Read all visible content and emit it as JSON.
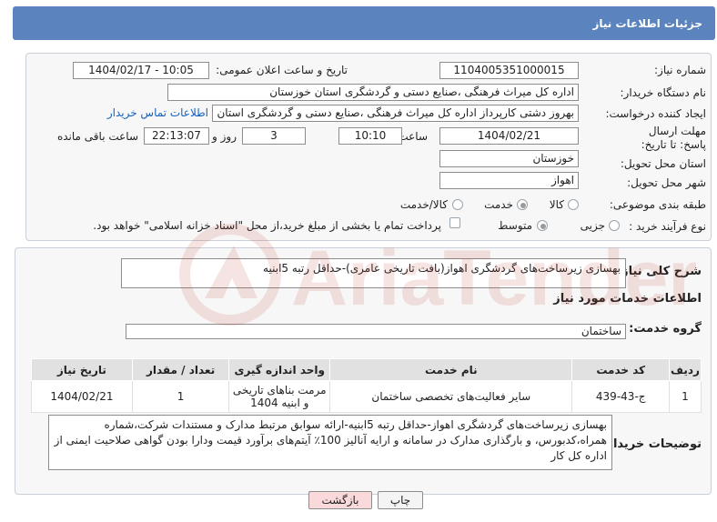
{
  "header": {
    "title": "جزئیات اطلاعات نیاز"
  },
  "form": {
    "need_number": {
      "label": "شماره نیاز:",
      "value": "1104005351000015"
    },
    "announce_datetime": {
      "label": "تاریخ و ساعت اعلان عمومی:",
      "value": "1404/02/17 - 10:05"
    },
    "buyer_org": {
      "label": "نام دستگاه خریدار:",
      "value": "اداره کل میراث فرهنگی ،صنایع دستی و گردشگری استان خوزستان"
    },
    "requester": {
      "label": "ایجاد کننده درخواست:",
      "value": "بهروز دشتی کارپرداز اداره کل میراث فرهنگی ،صنایع دستی و گردشگری استان خوزستان",
      "contact_link": "اطلاعات تماس خریدار"
    },
    "deadline": {
      "label": "مهلت ارسال پاسخ: تا تاریخ:",
      "date": "1404/02/21",
      "time_label": "ساعت",
      "time": "10:10",
      "days": "3",
      "days_label": "روز و",
      "remaining": "22:13:07",
      "remaining_label": "ساعت باقی مانده"
    },
    "province": {
      "label": "استان محل تحویل:",
      "value": "خوزستان"
    },
    "city": {
      "label": "شهر محل تحویل:",
      "value": "اهواز"
    },
    "category": {
      "label": "طبقه بندی موضوعی:",
      "options": [
        "کالا",
        "خدمت",
        "کالا/خدمت"
      ],
      "selected": "خدمت"
    },
    "purchase_type": {
      "label": "نوع فرآیند خرید :",
      "options": [
        "جزیی",
        "متوسط"
      ],
      "selected": "متوسط",
      "payment_note": "پرداخت تمام یا بخشی از مبلغ خرید،از محل \"اسناد خزانه اسلامی\" خواهد بود."
    }
  },
  "description": {
    "label": "شرح کلی نیاز:",
    "value": "بهسازی زیرساخت‌های گردشگری اهواز(بافت تاریخی عامری)-حداقل رتبه 5ابنیه"
  },
  "services": {
    "section_title": "اطلاعات خدمات مورد نیاز",
    "group_label": "گروه خدمت:",
    "group_value": "ساختمان",
    "columns": [
      "ردیف",
      "کد خدمت",
      "نام خدمت",
      "واحد اندازه گیری",
      "تعداد / مقدار",
      "تاریخ نیاز"
    ],
    "rows": [
      {
        "row": "1",
        "code": "ج-43-439",
        "name": "سایر فعالیت‌های تخصصی ساختمان",
        "unit": "مرمت بناهای تاریخی و ابنیه 1404",
        "qty": "1",
        "date": "1404/02/21"
      }
    ]
  },
  "buyer_notes": {
    "label": "توضیحات خریدار:",
    "value": "بهسازی زیرساخت‌های گردشگری اهواز-حداقل رتبه 5ابنیه-ارائه سوابق مرتبط مدارک و مستندات شرکت،شماره همراه،کدبورس، و بارگذاری مدارک در سامانه و ارایه آنالیز 100٪ آیتم‌های برآورد قیمت ودارا بودن گواهی صلاحیت ایمنی از اداره کل کار"
  },
  "buttons": {
    "print": "چاپ",
    "back": "بازگشت"
  },
  "watermark": {
    "text": "AriaTender.neT"
  },
  "colors": {
    "header": "#5b84bf",
    "link": "#1560bd",
    "back_button": "#f9d9d9",
    "watermark": "#c0392b"
  }
}
